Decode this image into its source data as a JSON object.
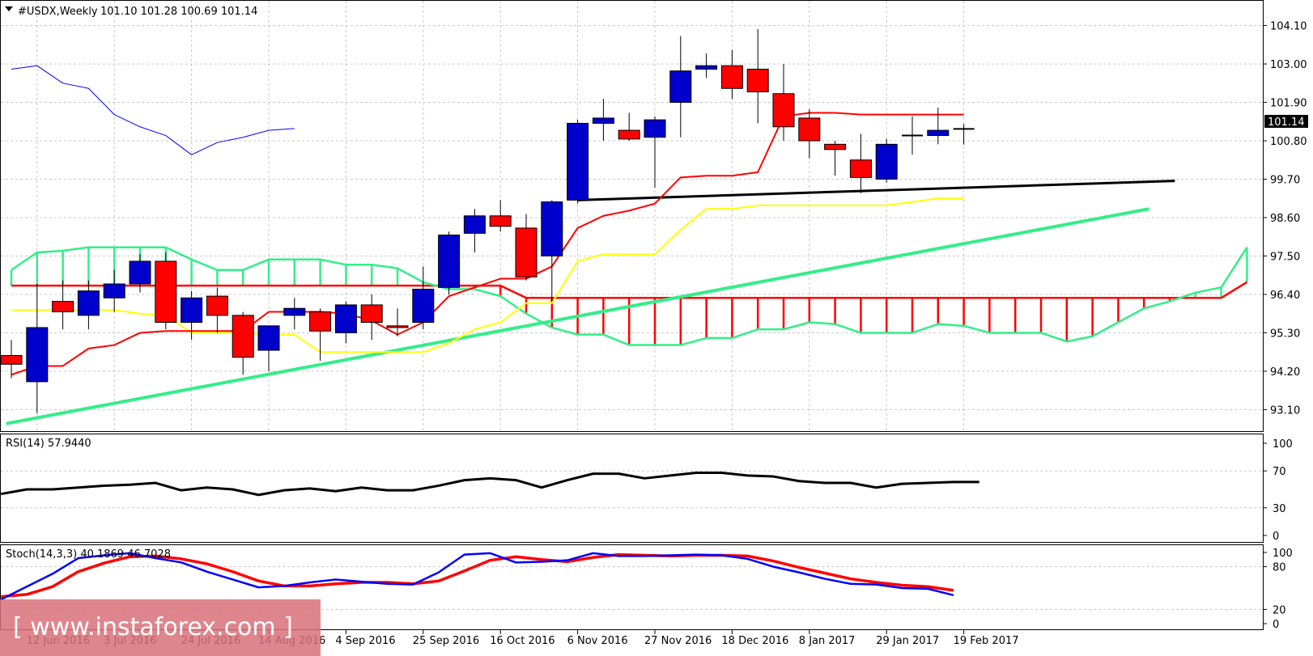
{
  "header": {
    "symbol": "#USDX,Weekly",
    "ohlc": "101.10 101.28 100.69 101.14"
  },
  "colors": {
    "bull": "#0000cc",
    "bear": "#ff0000",
    "tenkan": "#ff0000",
    "kijun": "#ffff00",
    "chikou": "#0000ff",
    "kumo_bull": "#33ee88",
    "kumo_bear": "#ff0000",
    "trendline_green": "#33ee88",
    "trendline_black": "#000000",
    "rsi": "#000000",
    "stoch_main": "#0000ff",
    "stoch_signal": "#ff0000",
    "watermark_bg": "#d9707a"
  },
  "chart_data": [
    {
      "type": "candlestick",
      "panel": "price",
      "title": "#USDX,Weekly 101.10 101.28 100.69 101.14",
      "ylim": [
        92.6,
        104.6
      ],
      "y_ticks": [
        "104.10",
        "103.00",
        "101.90",
        "100.80",
        "99.70",
        "98.60",
        "97.50",
        "96.40",
        "95.30",
        "94.20",
        "93.10"
      ],
      "last_price_label": "101.14",
      "x_tick_labels": [
        "12 Jun 2016",
        "3 Jul 2016",
        "24 Jul 2016",
        "14 Aug 2016",
        "4 Sep 2016",
        "25 Sep 2016",
        "16 Oct 2016",
        "6 Nov 2016",
        "27 Nov 2016",
        "18 Dec 2016",
        "8 Jan 2017",
        "29 Jan 2017",
        "19 Feb 2017"
      ],
      "x_tick_index": [
        1,
        4,
        7,
        10,
        13,
        16,
        19,
        22,
        25,
        28,
        31,
        34,
        37
      ],
      "candles": [
        {
          "o": 94.65,
          "h": 95.1,
          "l": 94.0,
          "c": 94.4
        },
        {
          "o": 93.9,
          "h": 96.7,
          "l": 93.0,
          "c": 95.45
        },
        {
          "o": 96.2,
          "h": 96.8,
          "l": 95.4,
          "c": 95.9
        },
        {
          "o": 95.8,
          "h": 96.8,
          "l": 95.4,
          "c": 96.5
        },
        {
          "o": 96.3,
          "h": 97.1,
          "l": 95.9,
          "c": 96.7
        },
        {
          "o": 96.7,
          "h": 97.55,
          "l": 96.45,
          "c": 97.35
        },
        {
          "o": 97.35,
          "h": 97.6,
          "l": 95.4,
          "c": 95.6
        },
        {
          "o": 95.6,
          "h": 96.5,
          "l": 95.1,
          "c": 96.3
        },
        {
          "o": 96.35,
          "h": 96.6,
          "l": 95.3,
          "c": 95.8
        },
        {
          "o": 95.8,
          "h": 95.9,
          "l": 94.1,
          "c": 94.6
        },
        {
          "o": 94.8,
          "h": 95.5,
          "l": 94.2,
          "c": 95.5
        },
        {
          "o": 95.8,
          "h": 96.3,
          "l": 95.4,
          "c": 96.0
        },
        {
          "o": 95.9,
          "h": 96.0,
          "l": 94.5,
          "c": 95.35
        },
        {
          "o": 95.3,
          "h": 96.2,
          "l": 95.0,
          "c": 96.1
        },
        {
          "o": 96.1,
          "h": 96.4,
          "l": 95.1,
          "c": 95.6
        },
        {
          "o": 95.5,
          "h": 96.0,
          "l": 95.2,
          "c": 95.45
        },
        {
          "o": 95.6,
          "h": 97.2,
          "l": 95.4,
          "c": 96.55
        },
        {
          "o": 96.6,
          "h": 98.2,
          "l": 96.4,
          "c": 98.1
        },
        {
          "o": 98.15,
          "h": 98.85,
          "l": 97.6,
          "c": 98.65
        },
        {
          "o": 98.65,
          "h": 99.1,
          "l": 98.2,
          "c": 98.35
        },
        {
          "o": 98.3,
          "h": 98.7,
          "l": 96.8,
          "c": 96.9
        },
        {
          "o": 97.5,
          "h": 99.1,
          "l": 96.2,
          "c": 99.05
        },
        {
          "o": 99.1,
          "h": 101.4,
          "l": 99.0,
          "c": 101.3
        },
        {
          "o": 101.3,
          "h": 102.0,
          "l": 100.8,
          "c": 101.45
        },
        {
          "o": 101.1,
          "h": 101.6,
          "l": 100.8,
          "c": 100.85
        },
        {
          "o": 100.9,
          "h": 101.5,
          "l": 99.45,
          "c": 101.4
        },
        {
          "o": 101.9,
          "h": 103.8,
          "l": 100.9,
          "c": 102.8
        },
        {
          "o": 102.85,
          "h": 103.3,
          "l": 102.6,
          "c": 102.95
        },
        {
          "o": 102.95,
          "h": 103.4,
          "l": 102.0,
          "c": 102.3
        },
        {
          "o": 102.85,
          "h": 104.0,
          "l": 101.3,
          "c": 102.2
        },
        {
          "o": 102.15,
          "h": 103.0,
          "l": 100.8,
          "c": 101.2
        },
        {
          "o": 101.45,
          "h": 101.7,
          "l": 100.3,
          "c": 100.8
        },
        {
          "o": 100.7,
          "h": 100.8,
          "l": 99.8,
          "c": 100.55
        },
        {
          "o": 100.25,
          "h": 101.0,
          "l": 99.3,
          "c": 99.75
        },
        {
          "o": 99.7,
          "h": 100.85,
          "l": 99.6,
          "c": 100.7
        },
        {
          "o": 100.95,
          "h": 101.5,
          "l": 100.4,
          "c": 100.95
        },
        {
          "o": 100.95,
          "h": 101.75,
          "l": 100.7,
          "c": 101.1
        },
        {
          "o": 101.1,
          "h": 101.28,
          "l": 100.69,
          "c": 101.14
        }
      ],
      "tenkan": [
        [
          0,
          94.1
        ],
        [
          1,
          94.35
        ],
        [
          2,
          94.35
        ],
        [
          3,
          94.85
        ],
        [
          4,
          94.95
        ],
        [
          5,
          95.3
        ],
        [
          6,
          95.35
        ],
        [
          7,
          95.35
        ],
        [
          8,
          95.35
        ],
        [
          9,
          95.35
        ],
        [
          10,
          95.9
        ],
        [
          11,
          95.9
        ],
        [
          12,
          95.9
        ],
        [
          13,
          95.85
        ],
        [
          14,
          95.65
        ],
        [
          15,
          95.25
        ],
        [
          16,
          95.6
        ],
        [
          17,
          96.35
        ],
        [
          18,
          96.6
        ],
        [
          19,
          96.85
        ],
        [
          20,
          96.85
        ],
        [
          21,
          97.2
        ],
        [
          22,
          98.3
        ],
        [
          23,
          98.65
        ],
        [
          24,
          98.8
        ],
        [
          25,
          99.0
        ],
        [
          26,
          99.75
        ],
        [
          27,
          99.8
        ],
        [
          28,
          99.8
        ],
        [
          29,
          99.9
        ],
        [
          30,
          101.5
        ],
        [
          31,
          101.6
        ],
        [
          32,
          101.6
        ],
        [
          33,
          101.55
        ],
        [
          34,
          101.55
        ],
        [
          35,
          101.55
        ],
        [
          36,
          101.55
        ],
        [
          37,
          101.55
        ]
      ],
      "kijun": [
        [
          0,
          95.95
        ],
        [
          1,
          95.95
        ],
        [
          2,
          95.95
        ],
        [
          3,
          95.95
        ],
        [
          4,
          95.95
        ],
        [
          5,
          95.85
        ],
        [
          6,
          95.8
        ],
        [
          7,
          95.3
        ],
        [
          8,
          95.3
        ],
        [
          9,
          95.3
        ],
        [
          10,
          95.25
        ],
        [
          11,
          95.25
        ],
        [
          12,
          94.75
        ],
        [
          13,
          94.75
        ],
        [
          14,
          94.75
        ],
        [
          15,
          94.75
        ],
        [
          16,
          94.75
        ],
        [
          17,
          95.0
        ],
        [
          18,
          95.4
        ],
        [
          19,
          95.6
        ],
        [
          20,
          96.15
        ],
        [
          21,
          96.15
        ],
        [
          22,
          97.35
        ],
        [
          23,
          97.55
        ],
        [
          24,
          97.55
        ],
        [
          25,
          97.55
        ],
        [
          26,
          98.25
        ],
        [
          27,
          98.85
        ],
        [
          28,
          98.85
        ],
        [
          29,
          98.95
        ],
        [
          30,
          98.95
        ],
        [
          31,
          98.95
        ],
        [
          32,
          98.95
        ],
        [
          33,
          98.95
        ],
        [
          34,
          98.95
        ],
        [
          35,
          99.05
        ],
        [
          36,
          99.15
        ],
        [
          37,
          99.15
        ]
      ],
      "chikou": [
        [
          0,
          102.85
        ],
        [
          1,
          102.95
        ],
        [
          2,
          102.45
        ],
        [
          3,
          102.3
        ],
        [
          4,
          101.55
        ],
        [
          5,
          101.2
        ],
        [
          6,
          100.95
        ],
        [
          7,
          100.4
        ],
        [
          8,
          100.75
        ],
        [
          9,
          100.9
        ],
        [
          10,
          101.1
        ],
        [
          11,
          101.15
        ]
      ],
      "senkou_a": [
        [
          0,
          97.1
        ],
        [
          1,
          97.6
        ],
        [
          2,
          97.65
        ],
        [
          3,
          97.75
        ],
        [
          4,
          97.75
        ],
        [
          5,
          97.75
        ],
        [
          6,
          97.75
        ],
        [
          7,
          97.4
        ],
        [
          8,
          97.1
        ],
        [
          9,
          97.1
        ],
        [
          10,
          97.4
        ],
        [
          11,
          97.4
        ],
        [
          12,
          97.4
        ],
        [
          13,
          97.25
        ],
        [
          14,
          97.25
        ],
        [
          15,
          97.15
        ],
        [
          16,
          96.75
        ],
        [
          17,
          96.55
        ],
        [
          18,
          96.55
        ],
        [
          19,
          96.35
        ],
        [
          20,
          95.85
        ],
        [
          21,
          95.45
        ],
        [
          22,
          95.25
        ],
        [
          23,
          95.25
        ],
        [
          24,
          94.95
        ],
        [
          25,
          94.95
        ],
        [
          26,
          94.95
        ],
        [
          27,
          95.15
        ],
        [
          28,
          95.15
        ],
        [
          29,
          95.4
        ],
        [
          30,
          95.4
        ],
        [
          31,
          95.6
        ],
        [
          32,
          95.55
        ],
        [
          33,
          95.3
        ],
        [
          34,
          95.3
        ],
        [
          35,
          95.3
        ],
        [
          36,
          95.55
        ],
        [
          37,
          95.5
        ],
        [
          38,
          95.3
        ],
        [
          39,
          95.3
        ],
        [
          40,
          95.3
        ],
        [
          41,
          95.05
        ],
        [
          42,
          95.2
        ],
        [
          43,
          95.6
        ],
        [
          44,
          96.0
        ],
        [
          45,
          96.2
        ],
        [
          46,
          96.45
        ],
        [
          47,
          96.6
        ],
        [
          48,
          97.75
        ]
      ],
      "senkou_b": [
        [
          0,
          96.65
        ],
        [
          1,
          96.65
        ],
        [
          2,
          96.65
        ],
        [
          3,
          96.65
        ],
        [
          4,
          96.65
        ],
        [
          5,
          96.65
        ],
        [
          6,
          96.65
        ],
        [
          7,
          96.65
        ],
        [
          8,
          96.65
        ],
        [
          9,
          96.65
        ],
        [
          10,
          96.65
        ],
        [
          11,
          96.65
        ],
        [
          12,
          96.65
        ],
        [
          13,
          96.65
        ],
        [
          14,
          96.65
        ],
        [
          15,
          96.65
        ],
        [
          16,
          96.65
        ],
        [
          17,
          96.65
        ],
        [
          18,
          96.65
        ],
        [
          19,
          96.65
        ],
        [
          20,
          96.3
        ],
        [
          21,
          96.3
        ],
        [
          22,
          96.3
        ],
        [
          23,
          96.3
        ],
        [
          24,
          96.3
        ],
        [
          25,
          96.3
        ],
        [
          26,
          96.3
        ],
        [
          27,
          96.3
        ],
        [
          28,
          96.3
        ],
        [
          29,
          96.3
        ],
        [
          30,
          96.3
        ],
        [
          31,
          96.3
        ],
        [
          32,
          96.3
        ],
        [
          33,
          96.3
        ],
        [
          34,
          96.3
        ],
        [
          35,
          96.3
        ],
        [
          36,
          96.3
        ],
        [
          37,
          96.3
        ],
        [
          38,
          96.3
        ],
        [
          39,
          96.3
        ],
        [
          40,
          96.3
        ],
        [
          41,
          96.3
        ],
        [
          42,
          96.3
        ],
        [
          43,
          96.3
        ],
        [
          44,
          96.3
        ],
        [
          45,
          96.3
        ],
        [
          46,
          96.3
        ],
        [
          47,
          96.3
        ],
        [
          48,
          96.75
        ]
      ],
      "trendlines": [
        {
          "color": "green",
          "from": [
            -0.2,
            92.7
          ],
          "to": [
            44.2,
            98.85
          ]
        },
        {
          "color": "black",
          "from": [
            22.0,
            99.1
          ],
          "to": [
            45.2,
            99.65
          ]
        }
      ]
    },
    {
      "type": "line",
      "panel": "rsi",
      "title": "RSI(14) 57.9440",
      "ylim": [
        0,
        100
      ],
      "y_ticks": [
        "100",
        "70",
        "30",
        "0"
      ],
      "levels": [
        70,
        30
      ],
      "series": [
        {
          "values": [
            45,
            50,
            50,
            52,
            54,
            55,
            57,
            49,
            52,
            50,
            44,
            49,
            51,
            48,
            52,
            49,
            49,
            54,
            60,
            62,
            60,
            52,
            60,
            67,
            67,
            62,
            65,
            68,
            68,
            65,
            64,
            59,
            57,
            57,
            52,
            56,
            57,
            58,
            58
          ]
        }
      ]
    },
    {
      "type": "line",
      "panel": "stoch",
      "title": "Stoch(14,3,3) 40.1869 46.7028",
      "ylim": [
        0,
        100
      ],
      "y_ticks": [
        "100",
        "80",
        "20",
        "0"
      ],
      "levels": [
        80,
        20
      ],
      "series": [
        {
          "values": [
            34,
            52,
            70,
            92,
            96,
            99,
            92,
            86,
            73,
            62,
            51,
            53,
            58,
            62,
            59,
            56,
            55,
            72,
            97,
            99,
            86,
            87,
            89,
            99,
            95,
            95,
            96,
            97,
            96,
            91,
            80,
            72,
            63,
            56,
            55,
            50,
            49,
            40
          ]
        },
        {
          "values": [
            38,
            41,
            52,
            73,
            85,
            94,
            95,
            91,
            84,
            73,
            60,
            53,
            53,
            56,
            58,
            58,
            56,
            60,
            74,
            89,
            94,
            90,
            87,
            93,
            97,
            96,
            95,
            96,
            96,
            95,
            88,
            79,
            71,
            63,
            58,
            54,
            52,
            46.7
          ]
        }
      ]
    }
  ],
  "watermark": {
    "text": "[  www.instaforex.com  ]"
  }
}
